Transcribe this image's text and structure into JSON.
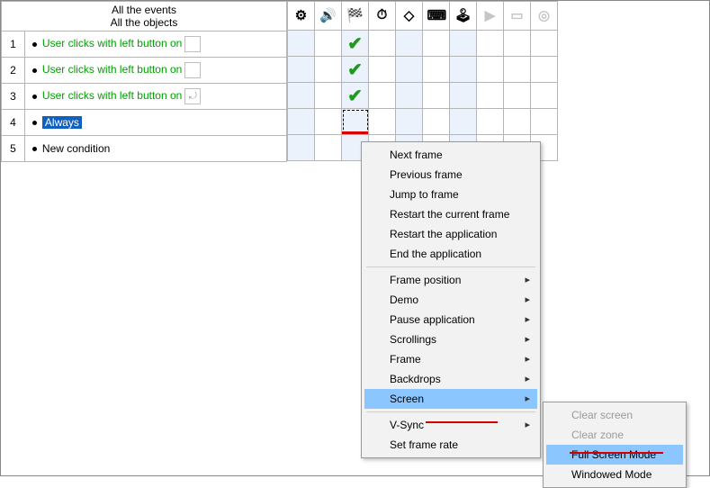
{
  "header": {
    "events_line1": "All the events",
    "events_line2": "All the objects"
  },
  "rows": [
    {
      "num": "1",
      "text": "User clicks with left button on",
      "style": "green",
      "slot": ""
    },
    {
      "num": "2",
      "text": "User clicks with left button on",
      "style": "green",
      "slot": ""
    },
    {
      "num": "3",
      "text": "User clicks with left button on",
      "style": "green",
      "slot": "⤾"
    },
    {
      "num": "4",
      "text": "Always",
      "style": "highlight"
    },
    {
      "num": "5",
      "text": "New condition",
      "style": "black"
    }
  ],
  "grid_icons": [
    "gears-icon",
    "sound-icon",
    "storyboard-icon",
    "timer-icon",
    "new-objects-icon",
    "keyboard-icon",
    "joystick-icon",
    "play-icon",
    "window-icon",
    "app-icon"
  ],
  "checks": {
    "col": 2,
    "rows": [
      0,
      1,
      2
    ]
  },
  "selected_cell": {
    "row": 3,
    "col": 2
  },
  "menu_main": {
    "items": [
      {
        "label": "Next frame"
      },
      {
        "label": "Previous frame"
      },
      {
        "label": "Jump to frame"
      },
      {
        "label": "Restart the current frame"
      },
      {
        "label": "Restart the application"
      },
      {
        "label": "End the application"
      },
      {
        "sep": true
      },
      {
        "label": "Frame position",
        "sub": true
      },
      {
        "label": "Demo",
        "sub": true
      },
      {
        "label": "Pause application",
        "sub": true
      },
      {
        "label": "Scrollings",
        "sub": true
      },
      {
        "label": "Frame",
        "sub": true
      },
      {
        "label": "Backdrops",
        "sub": true
      },
      {
        "label": "Screen",
        "sub": true,
        "sel": true
      },
      {
        "sep": true
      },
      {
        "label": "V-Sync",
        "sub": true
      },
      {
        "label": "Set frame rate"
      }
    ]
  },
  "menu_sub": {
    "items": [
      {
        "label": "Clear screen",
        "disabled": true
      },
      {
        "label": "Clear zone",
        "disabled": true
      },
      {
        "label": "Full Screen Mode",
        "sel": true
      },
      {
        "label": "Windowed Mode"
      }
    ]
  }
}
